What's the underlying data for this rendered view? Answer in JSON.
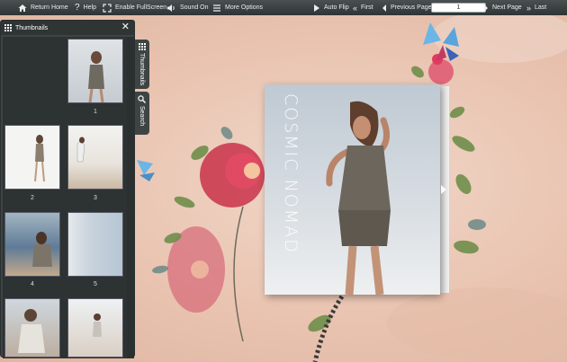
{
  "toolbar": {
    "return_home": "Return Home",
    "help": "Help",
    "fullscreen": "Enable FullScreen",
    "sound": "Sound On",
    "more": "More Options",
    "auto_flip": "Auto Flip",
    "first": "First",
    "previous": "Previous Page",
    "page_value": "1",
    "next": "Next Page",
    "last": "Last"
  },
  "panel": {
    "title": "Thumbnails",
    "thumb_labels": [
      "1",
      "2",
      "3",
      "4",
      "5"
    ]
  },
  "sidetabs": {
    "thumbnails": "Thumbnails",
    "search": "Search"
  },
  "book": {
    "title": "COSMIC NOMAD"
  }
}
